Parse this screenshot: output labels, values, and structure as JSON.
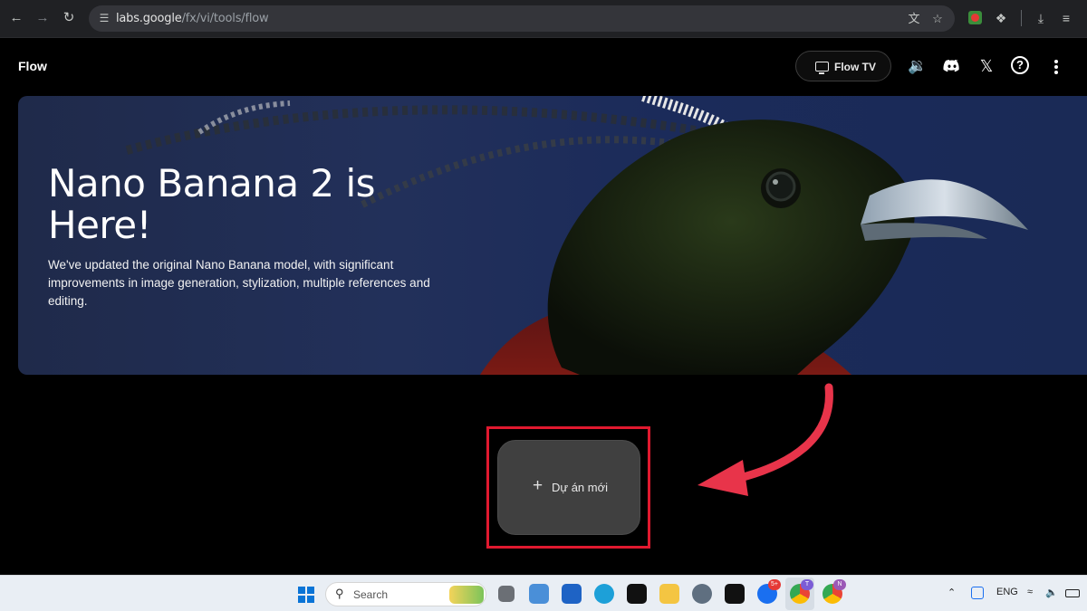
{
  "browser": {
    "url_host": "labs.google",
    "url_path": "/fx/vi/tools/flow"
  },
  "app": {
    "title": "Flow",
    "flow_tv_label": "Flow TV",
    "help_glyph": "?"
  },
  "hero": {
    "title": "Nano Banana 2 is Here!",
    "description": "We've updated the original Nano Banana model, with significant improvements in image generation, stylization, multiple references and editing."
  },
  "new_project": {
    "plus": "+",
    "label": "Dự án mới"
  },
  "taskbar": {
    "search_label": "Search",
    "language": "ENG",
    "zalo_badge": "5+",
    "chrome_badge_1": "T",
    "chrome_badge_2": "N"
  },
  "colors": {
    "highlight": "#e0192f",
    "arrow": "#e8344a",
    "hero_bg": "#1b2b5a"
  },
  "icons": [
    "back-arrow-icon",
    "forward-arrow-icon",
    "reload-icon",
    "site-settings-icon",
    "translate-icon",
    "bookmark-star-icon",
    "extensions-icon",
    "download-icon",
    "tv-icon",
    "volume-icon",
    "discord-icon",
    "x-icon",
    "help-icon",
    "more-vert-icon"
  ]
}
